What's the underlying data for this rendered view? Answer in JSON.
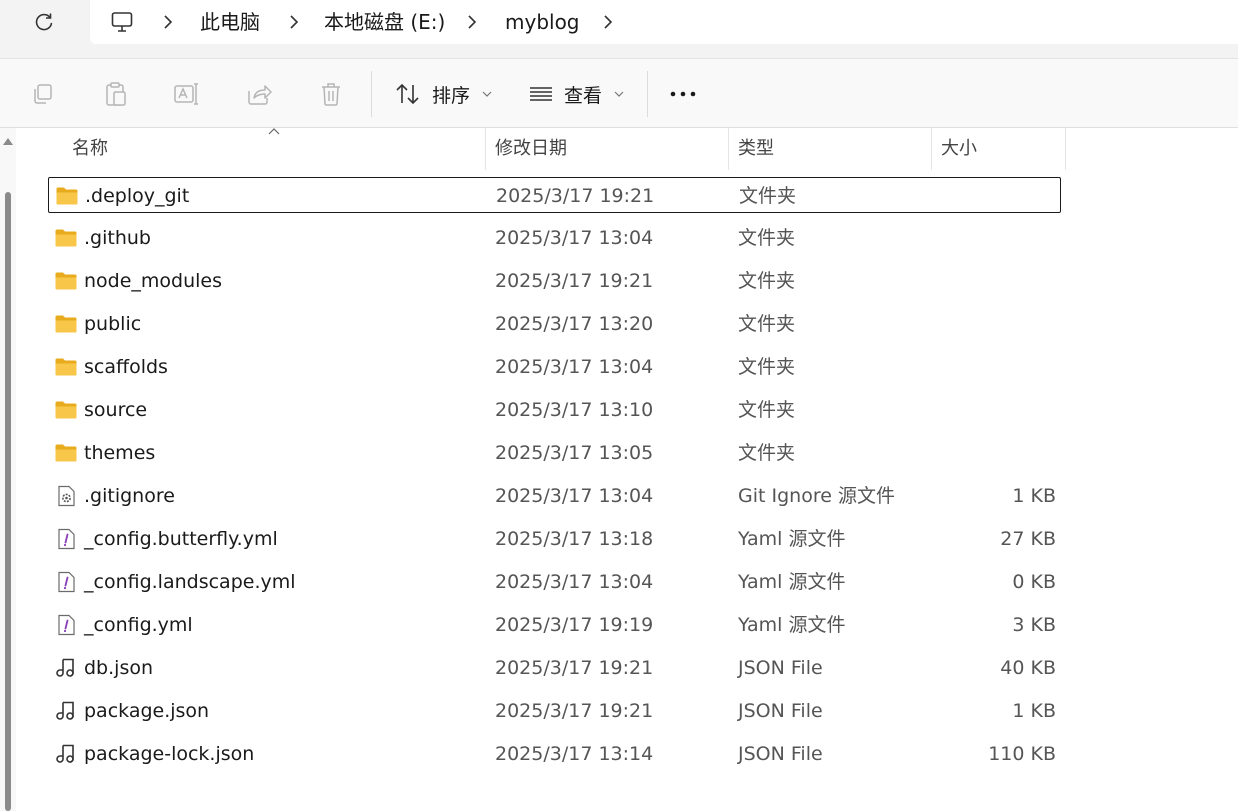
{
  "breadcrumb": {
    "items": [
      "此电脑",
      "本地磁盘 (E:)",
      "myblog"
    ]
  },
  "toolbar": {
    "sort_label": "排序",
    "view_label": "查看",
    "more_label": "···"
  },
  "columns": {
    "name": "名称",
    "modified": "修改日期",
    "type": "类型",
    "size": "大小"
  },
  "files": [
    {
      "name": ".deploy_git",
      "modified": "2025/3/17 19:21",
      "type": "文件夹",
      "size": "",
      "icon": "folder-icon",
      "selected": true
    },
    {
      "name": ".github",
      "modified": "2025/3/17 13:04",
      "type": "文件夹",
      "size": "",
      "icon": "folder-icon"
    },
    {
      "name": "node_modules",
      "modified": "2025/3/17 19:21",
      "type": "文件夹",
      "size": "",
      "icon": "folder-icon"
    },
    {
      "name": "public",
      "modified": "2025/3/17 13:20",
      "type": "文件夹",
      "size": "",
      "icon": "folder-icon"
    },
    {
      "name": "scaffolds",
      "modified": "2025/3/17 13:04",
      "type": "文件夹",
      "size": "",
      "icon": "folder-icon"
    },
    {
      "name": "source",
      "modified": "2025/3/17 13:10",
      "type": "文件夹",
      "size": "",
      "icon": "folder-icon"
    },
    {
      "name": "themes",
      "modified": "2025/3/17 13:05",
      "type": "文件夹",
      "size": "",
      "icon": "folder-icon"
    },
    {
      "name": ".gitignore",
      "modified": "2025/3/17 13:04",
      "type": "Git Ignore 源文件",
      "size": "1 KB",
      "icon": "config-file-icon"
    },
    {
      "name": "_config.butterfly.yml",
      "modified": "2025/3/17 13:18",
      "type": "Yaml 源文件",
      "size": "27 KB",
      "icon": "yaml-file-icon"
    },
    {
      "name": "_config.landscape.yml",
      "modified": "2025/3/17 13:04",
      "type": "Yaml 源文件",
      "size": "0 KB",
      "icon": "yaml-file-icon"
    },
    {
      "name": "_config.yml",
      "modified": "2025/3/17 19:19",
      "type": "Yaml 源文件",
      "size": "3 KB",
      "icon": "yaml-file-icon"
    },
    {
      "name": "db.json",
      "modified": "2025/3/17 19:21",
      "type": "JSON File",
      "size": "40 KB",
      "icon": "json-file-icon"
    },
    {
      "name": "package.json",
      "modified": "2025/3/17 19:21",
      "type": "JSON File",
      "size": "1 KB",
      "icon": "json-file-icon"
    },
    {
      "name": "package-lock.json",
      "modified": "2025/3/17 13:14",
      "type": "JSON File",
      "size": "110 KB",
      "icon": "json-file-icon"
    }
  ],
  "colors": {
    "folder_yellow": "#f8c74a",
    "folder_yellow_dark": "#e9ab1e",
    "yaml_purple": "#8a3fb8",
    "selection_border": "#1a1a1a"
  }
}
